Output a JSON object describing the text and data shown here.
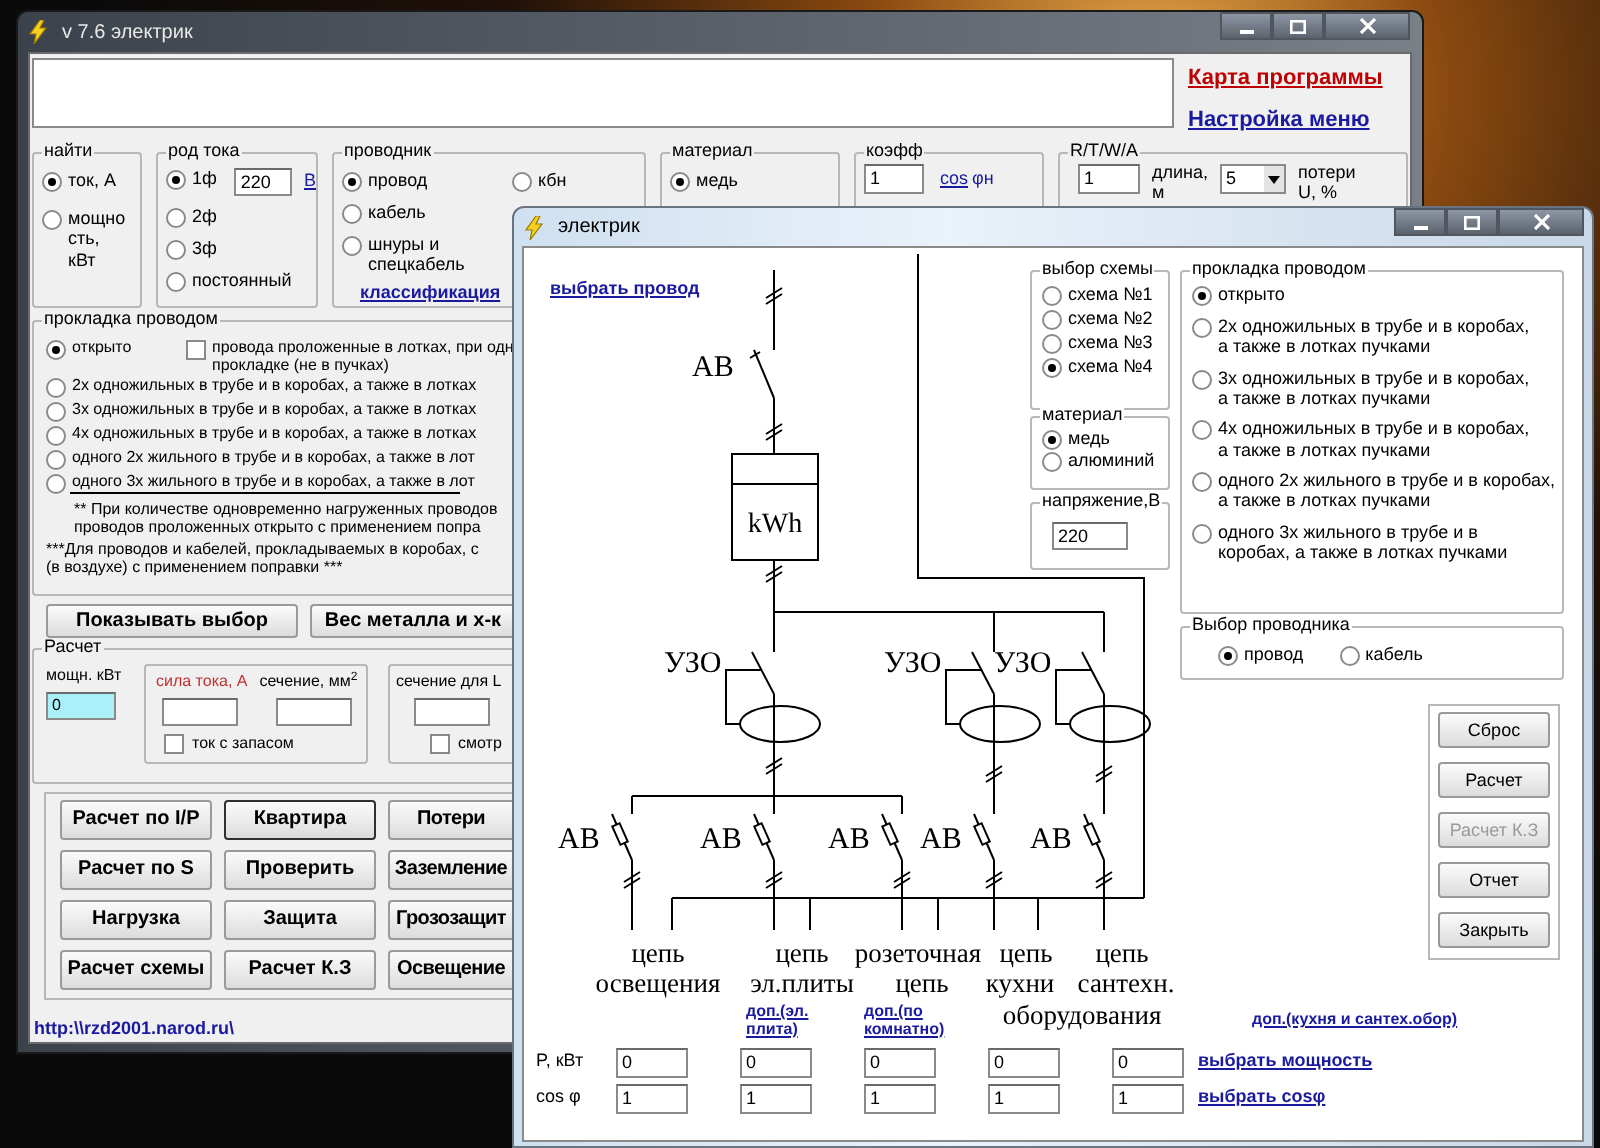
{
  "main_window": {
    "title": "v 7.6 электрик",
    "links": [
      {
        "text": "Карта программы",
        "color": "#c00000"
      },
      {
        "text": "Настройка меню",
        "color": "#1a1aa0"
      }
    ],
    "find": {
      "title": "найти",
      "options": [
        {
          "label": "ток, А",
          "selected": true
        },
        {
          "label": "мощно\nсть,\nкВт",
          "selected": false
        }
      ]
    },
    "current": {
      "title": "род тока",
      "options": [
        {
          "label": "1ф",
          "selected": true
        },
        {
          "label": "2ф",
          "selected": false
        },
        {
          "label": "3ф",
          "selected": false
        },
        {
          "label": "постоянный",
          "selected": false
        }
      ],
      "voltage": "220",
      "unit_link": "В"
    },
    "conductor": {
      "title": "проводник",
      "options": [
        {
          "label": "провод",
          "selected": true
        },
        {
          "label": "кабель",
          "selected": false
        },
        {
          "label": "шнуры и\nспецкабель",
          "selected": false
        },
        {
          "label": "кбн",
          "selected": false
        }
      ],
      "link": "классификация"
    },
    "material": {
      "title": "материал",
      "options": [
        {
          "label": "медь",
          "selected": true
        }
      ]
    },
    "coeff": {
      "title": "коэфф",
      "value": "1",
      "link": "cos",
      "suffix": "φн"
    },
    "rtwa": {
      "title": "R/T/W/A",
      "value": "1",
      "length_label": "длина,\nм",
      "select": "5",
      "loss_label": "потери\nU, %"
    },
    "laying": {
      "title": "прокладка проводом",
      "options": [
        {
          "label": "открыто",
          "selected": true
        },
        {
          "label": "2х одножильных в трубе и в коробах, а также в лотках",
          "selected": false
        },
        {
          "label": "3х одножильных в трубе и в коробах, а также в лотках",
          "selected": false
        },
        {
          "label": "4х одножильных в трубе и в коробах, а также в лотках",
          "selected": false
        },
        {
          "label": "одного 2х жильного в трубе и в коробах, а также в лот",
          "selected": false
        },
        {
          "label": "одного 3х жильного в трубе и в коробах, а также в лот",
          "selected": false
        }
      ],
      "checkbox": {
        "label": "провода проложенные в лотках, при одн\nпрокладке (не в пучках)",
        "checked": false
      },
      "notes": [
        "** При количестве одновременно нагруженных проводов\nпроводов проложенных открыто с применением попра",
        "***Для проводов и кабелей, прокладываемых в коробах, с\n(в воздухе) с применением поправки ***"
      ]
    },
    "action_buttons": [
      "Показывать выбор",
      "Вес металла и х-к"
    ],
    "calc": {
      "title": "Расчет",
      "power_label": "мощн. кВт",
      "power_value": "0",
      "current_label": "сила тока, А",
      "section_label": "сечение, мм$^{2}$",
      "reserve": {
        "label": "ток с запасом",
        "checked": false
      },
      "section_l_label": "сечение для L",
      "view": {
        "label": "смотр",
        "checked": false
      }
    },
    "buttons": [
      {
        "label": "Расчет по I/P",
        "focused": false
      },
      {
        "label": "Квартира",
        "focused": true
      },
      {
        "label": "Потери",
        "focused": false
      },
      {
        "label": "Расчет по S",
        "focused": false
      },
      {
        "label": "Проверить",
        "focused": false
      },
      {
        "label": "Заземление",
        "focused": false
      },
      {
        "label": "Нагрузка",
        "focused": false
      },
      {
        "label": "Защита",
        "focused": false
      },
      {
        "label": "Грозозащит",
        "focused": false
      },
      {
        "label": "Расчет схемы",
        "focused": false
      },
      {
        "label": "Расчет К.З",
        "focused": false
      },
      {
        "label": "Освещение",
        "focused": false
      }
    ],
    "url": "http:\\\\rzd2001.narod.ru\\"
  },
  "dialog": {
    "title": "электрик",
    "wire_link": "выбрать провод",
    "diagram": {
      "main_breaker": "АВ",
      "meter": "kWh",
      "rcd_labels": [
        "УЗО",
        "УЗО",
        "УЗО"
      ],
      "breaker_labels": [
        "АВ",
        "АВ",
        "АВ",
        "АВ",
        "АВ"
      ],
      "circuits": [
        [
          "цепь",
          "освещения"
        ],
        [
          "цепь",
          "эл.плиты"
        ],
        [
          "розеточная",
          "цепь"
        ],
        [
          "цепь",
          "кухни"
        ],
        [
          "цепь",
          "сантехн.",
          "оборудования"
        ]
      ]
    },
    "scheme": {
      "title": "выбор схемы",
      "options": [
        {
          "label": "схема №1",
          "selected": false
        },
        {
          "label": "схема №2",
          "selected": false
        },
        {
          "label": "схема №3",
          "selected": false
        },
        {
          "label": "схема №4",
          "selected": true
        }
      ]
    },
    "material": {
      "title": "материал",
      "options": [
        {
          "label": "медь",
          "selected": true
        },
        {
          "label": "алюминий",
          "selected": false
        }
      ]
    },
    "voltage": {
      "title": "напряжение,В",
      "value": "220"
    },
    "laying": {
      "title": "прокладка проводом",
      "options": [
        {
          "label": "открыто",
          "selected": true
        },
        {
          "label": "2х одножильных в трубе и в коробах,\nа также в лотках пучками",
          "selected": false
        },
        {
          "label": "3х одножильных в трубе и в коробах,\nа также в лотках пучками",
          "selected": false
        },
        {
          "label": "4х одножильных в трубе и в коробах,\nа также в лотках пучками",
          "selected": false
        },
        {
          "label": "одного 2х жильного в трубе и в коробах,\nа также в лотках пучками",
          "selected": false
        },
        {
          "label": "одного 3х жильного в трубе и в\nкоробах, а также в лотках пучками",
          "selected": false
        }
      ]
    },
    "conductor": {
      "title": "Выбор проводника",
      "options": [
        {
          "label": "провод",
          "selected": true
        },
        {
          "label": "кабель",
          "selected": false
        }
      ]
    },
    "buttons": [
      {
        "label": "Сброс",
        "disabled": false
      },
      {
        "label": "Расчет",
        "disabled": false
      },
      {
        "label": "Расчет К.З",
        "disabled": true
      },
      {
        "label": "Отчет",
        "disabled": false
      },
      {
        "label": "Закрыть",
        "disabled": false
      }
    ],
    "extra_links": [
      "доп.(эл.\nплита)",
      "доп.(по\nкомнатно)",
      "доп.(кухня и сантех.обор)"
    ],
    "power_row": {
      "label": "P, кВт",
      "values": [
        "0",
        "0",
        "0",
        "0",
        "0"
      ],
      "link": "выбрать мощность"
    },
    "cos_row": {
      "label": "cos φ",
      "values": [
        "1",
        "1",
        "1",
        "1",
        "1"
      ],
      "link": "выбрать cosφ"
    }
  }
}
